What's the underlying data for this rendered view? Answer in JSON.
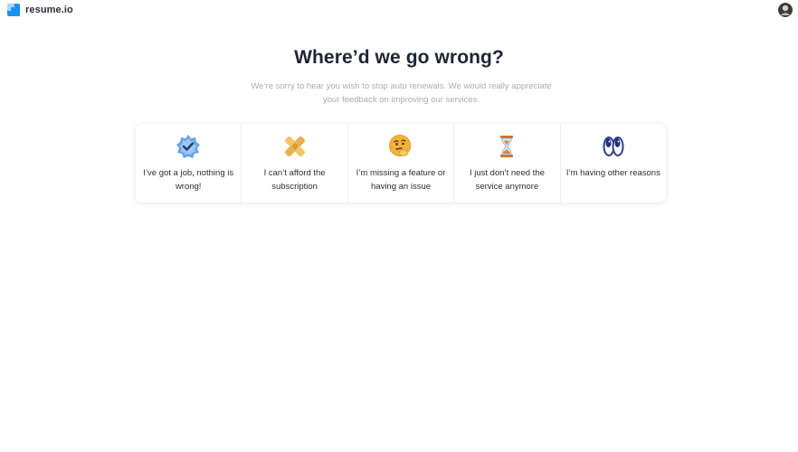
{
  "header": {
    "brand": "resume.io",
    "logo_icon": "resume-io-logo-icon",
    "avatar_icon": "user-avatar-icon"
  },
  "main": {
    "title": "Where’d we go wrong?",
    "subtitle": "We’re sorry to hear you wish to stop auto renewals. We would really appreciate your feedback on improving our services."
  },
  "reasons": [
    {
      "icon": "verified-badge-icon",
      "label": "I’ve got a job, nothing is wrong!"
    },
    {
      "icon": "cross-bandage-icon",
      "label": "I can’t afford the subscription"
    },
    {
      "icon": "thinking-face-icon",
      "label": "I’m missing a feature or having an issue"
    },
    {
      "icon": "hourglass-icon",
      "label": "I just don’t need the service anymore"
    },
    {
      "icon": "eyes-icon",
      "label": "I’m having other reasons"
    }
  ],
  "colors": {
    "brand_blue": "#1a91f0",
    "title": "#1e2532",
    "subtitle": "#a9adb6"
  }
}
